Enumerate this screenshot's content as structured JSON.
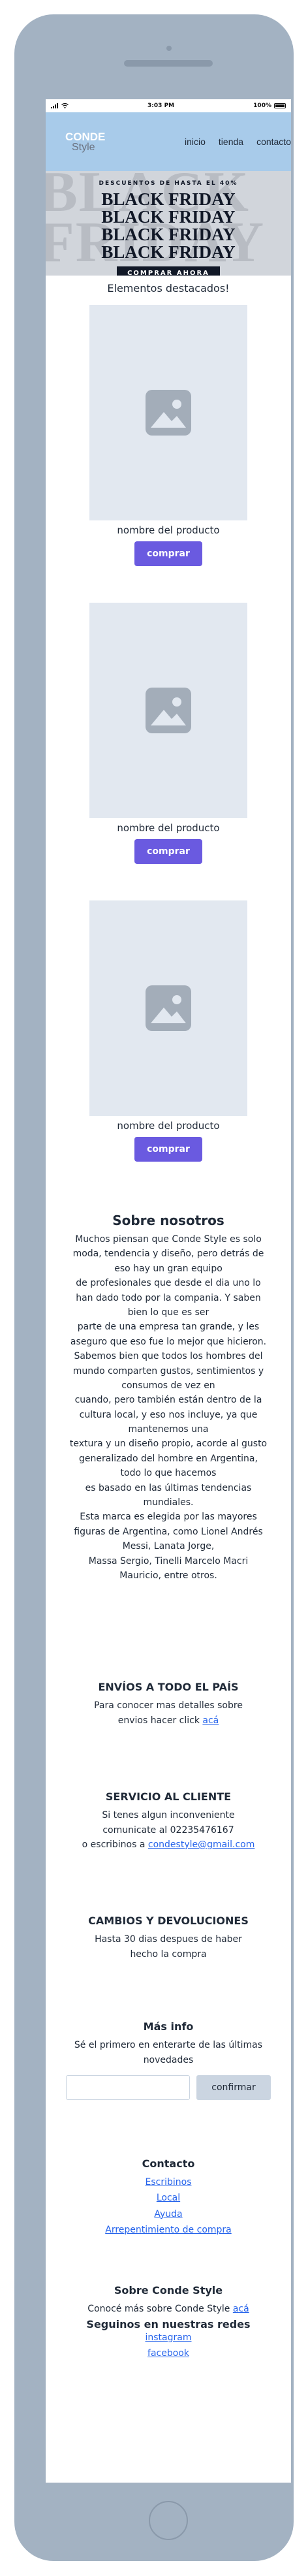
{
  "status_bar": {
    "time": "3:03 PM",
    "battery": "100%"
  },
  "header": {
    "logo_main": "CONDE",
    "logo_sub": "Style",
    "nav": [
      "inicio",
      "tienda",
      "contacto"
    ]
  },
  "hero": {
    "kicker": "DESCUENTOS DE HASTA EL 40%",
    "background_text": [
      "BLACK",
      "FRIDAY"
    ],
    "lines": [
      "BLACK FRIDAY",
      "BLACK FRIDAY",
      "BLACK FRIDAY",
      "BLACK FRIDAY"
    ],
    "button": "COMPRAR AHORA"
  },
  "featured": {
    "title": "Elementos destacados!",
    "products": [
      {
        "name": "nombre del producto",
        "button": "comprar",
        "icon": "image-placeholder-icon"
      },
      {
        "name": "nombre del producto",
        "button": "comprar",
        "icon": "image-placeholder-icon"
      },
      {
        "name": "nombre del producto",
        "button": "comprar",
        "icon": "image-placeholder-icon"
      }
    ]
  },
  "about": {
    "title": "Sobre nosotros",
    "lines": [
      "Muchos piensan que Conde Style es solo",
      "moda, tendencia y diseño, pero detrás de",
      "eso hay un gran equipo",
      "de profesionales que desde el dia uno lo",
      "han dado todo por la compania. Y saben",
      "bien lo que es ser",
      "parte de una empresa tan grande, y les",
      "aseguro que eso fue lo mejor que hicieron.",
      "Sabemos bien que todos los hombres del",
      "mundo comparten gustos, sentimientos y",
      "consumos de vez en",
      "cuando, pero también están dentro de la",
      "cultura local, y eso nos incluye, ya que",
      "mantenemos una",
      "textura y un diseño propio, acorde al gusto",
      "generalizado del hombre en Argentina,",
      "todo lo que hacemos",
      "es basado en las últimas tendencias",
      "mundiales.",
      "Esta marca es elegida por las mayores",
      "figuras de Argentina, como Lionel Andrés",
      "Messi, Lanata Jorge,",
      "Massa Sergio, Tinelli Marcelo Macri",
      "Mauricio, entre otros."
    ]
  },
  "shipping": {
    "title": "ENVÍOS A TODO EL PAÍS",
    "line1": "Para conocer mas detalles sobre",
    "line2_prefix": "envios hacer click ",
    "link": "acá"
  },
  "customer_service": {
    "title": "SERVICIO AL CLIENTE",
    "line1": "Si tenes algun inconveniente",
    "line2": "comunicate al 02235476167",
    "line3_prefix": "o escribinos a ",
    "email": "condestyle@gmail.com"
  },
  "returns": {
    "title": "CAMBIOS Y DEVOLUCIONES",
    "line1": "Hasta 30 dias despues de haber",
    "line2": "hecho la compra"
  },
  "more_info": {
    "title": "Más info",
    "line1": "Sé el primero en enterarte de las últimas",
    "line2": "novedades",
    "input_placeholder": "",
    "button": "confirmar"
  },
  "contact": {
    "title": "Contacto",
    "links": [
      "Escribinos",
      "Local",
      "Ayuda",
      "Arrepentimiento de compra"
    ]
  },
  "about_footer": {
    "title": "Sobre Conde Style",
    "line_prefix": "Conocé más sobre Conde Style ",
    "link": "acá",
    "social_title": "Seguinos en nuestras redes",
    "social_links": [
      "instagram",
      "facebook"
    ]
  },
  "colors": {
    "device_frame": "#a3b2c2",
    "header_bg": "#a8cbea",
    "hero_bg": "#d1d5db",
    "product_placeholder": "#e2e8f0",
    "buy_button": "#6a5ae0",
    "link": "#2563eb",
    "confirm_button": "#cbd5e1"
  }
}
